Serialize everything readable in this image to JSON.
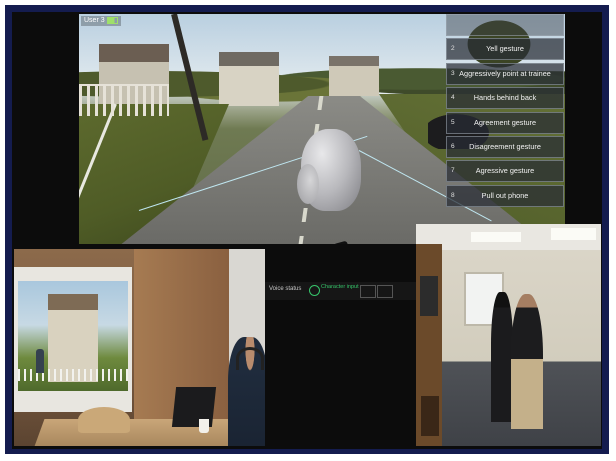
{
  "vr_view": {
    "user_label": "User 3",
    "gesture_menu": [
      {
        "number": "",
        "label": ""
      },
      {
        "number": "2",
        "label": "Yell gesture"
      },
      {
        "number": "3",
        "label": "Aggressively point at trainee"
      },
      {
        "number": "4",
        "label": "Hands behind back"
      },
      {
        "number": "5",
        "label": "Agreement gesture"
      },
      {
        "number": "6",
        "label": "Disagreement gesture"
      },
      {
        "number": "7",
        "label": "Agressive gesture"
      },
      {
        "number": "8",
        "label": "Pull out phone"
      }
    ]
  },
  "voice_bar": {
    "label": "Voice status",
    "status": "Character input",
    "button_1": "",
    "button_2": ""
  },
  "colors": {
    "frame_border": "#141c4f",
    "voice_active": "#36c46a"
  }
}
